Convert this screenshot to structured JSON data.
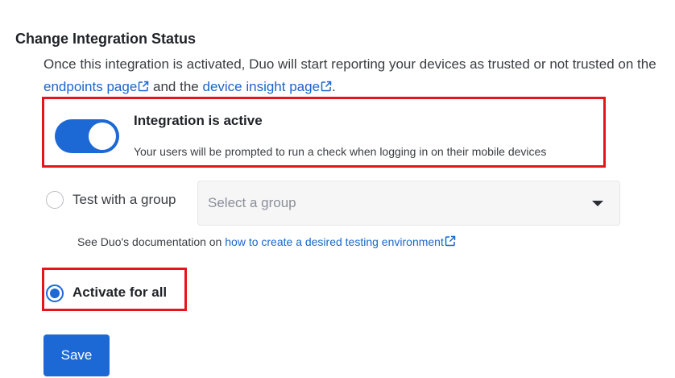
{
  "section": {
    "title": "Change Integration Status",
    "description_part1": "Once this integration is activated, Duo will start reporting your devices as trusted or not trusted on the",
    "endpoints_link": "endpoints page",
    "description_part2": "and the",
    "device_insight_link": "device insight page",
    "description_end": "."
  },
  "toggle": {
    "state": "on",
    "title": "Integration is active",
    "subtitle": "Your users will be prompted to run a check when logging in on their mobile devices"
  },
  "options": {
    "test_group_label": "Test with a group",
    "test_group_selected": false,
    "select_placeholder": "Select a group",
    "docs_text": "See Duo's documentation on",
    "docs_link": "how to create a desired testing environment",
    "activate_all_label": "Activate for all",
    "activate_all_selected": true
  },
  "actions": {
    "save_label": "Save"
  },
  "colors": {
    "accent": "#1c68d4",
    "link": "#1a66c9",
    "highlight": "#e8141b"
  },
  "icons": [
    "external-link-icon",
    "chevron-down-icon"
  ]
}
